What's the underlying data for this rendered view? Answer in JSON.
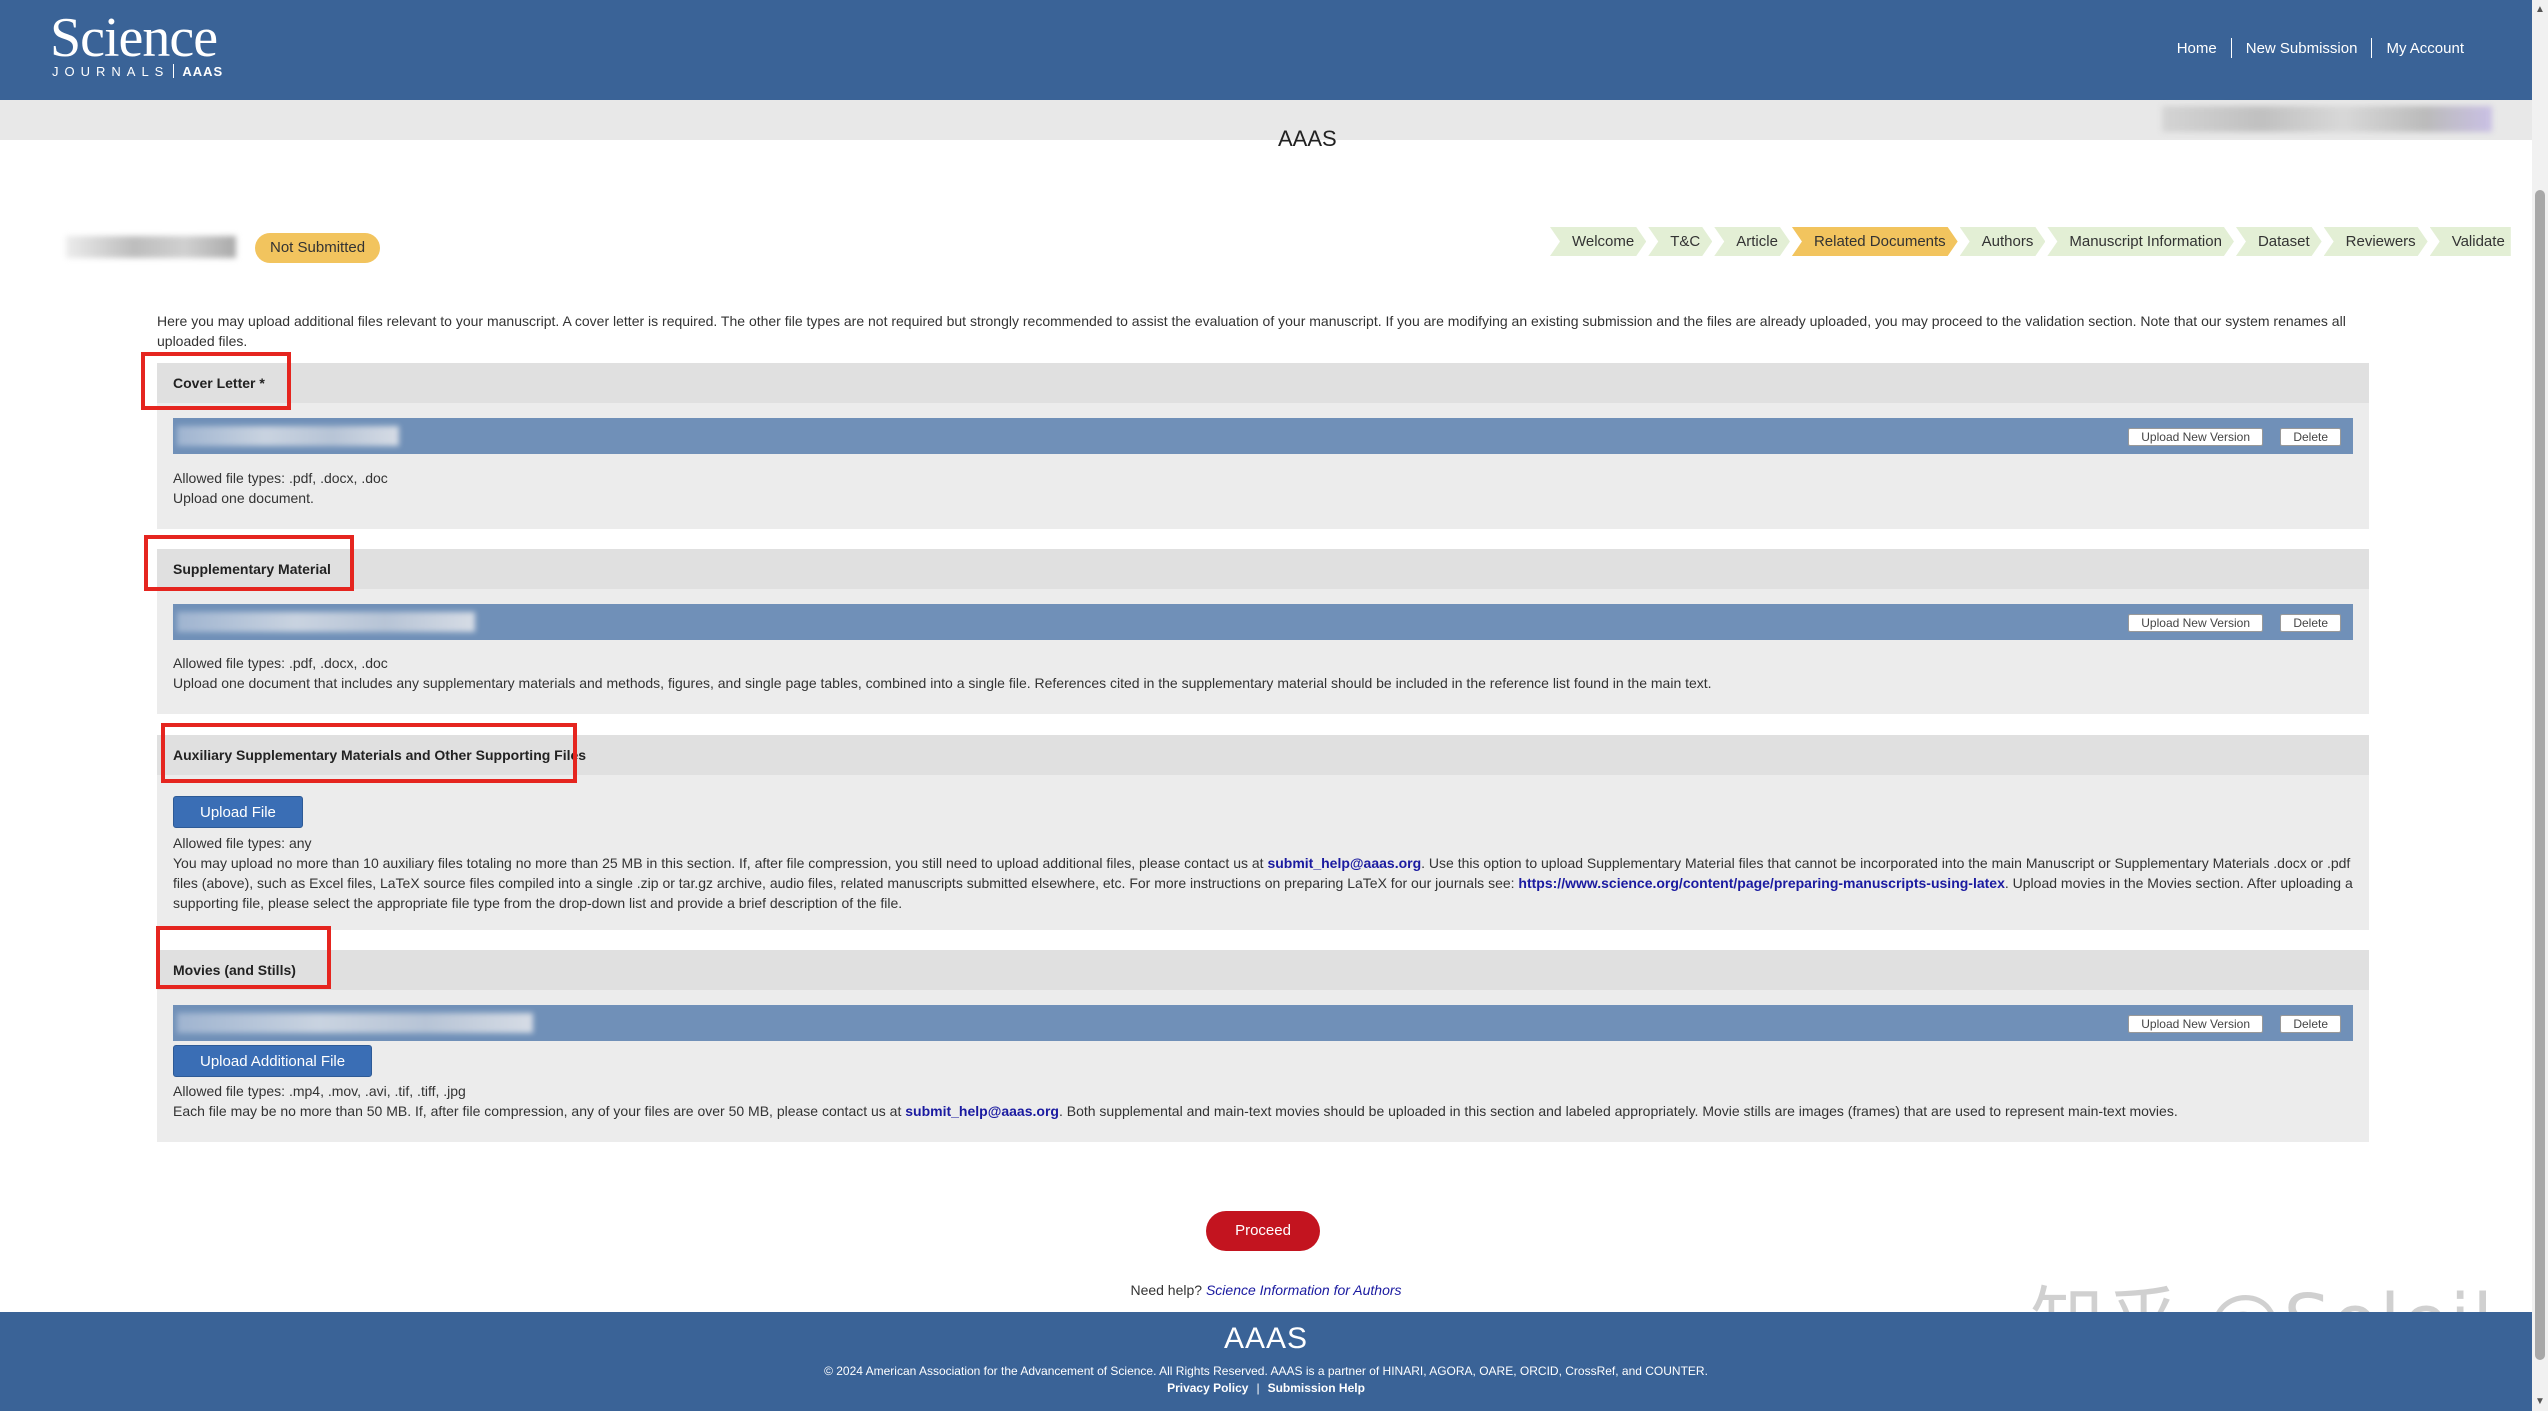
{
  "header": {
    "logo_main": "Science",
    "logo_sub": "JOURNALS",
    "logo_aaas": "AAAS",
    "nav": [
      "Home",
      "New Submission",
      "My Account"
    ]
  },
  "status": {
    "badge": "Not Submitted"
  },
  "steps": [
    {
      "label": "Welcome",
      "active": false
    },
    {
      "label": "T&C",
      "active": false
    },
    {
      "label": "Article",
      "active": false
    },
    {
      "label": "Related Documents",
      "active": true
    },
    {
      "label": "Authors",
      "active": false
    },
    {
      "label": "Manuscript Information",
      "active": false
    },
    {
      "label": "Dataset",
      "active": false
    },
    {
      "label": "Reviewers",
      "active": false
    },
    {
      "label": "Validate",
      "active": false
    }
  ],
  "intro": "Here you may upload additional files relevant to your manuscript. A cover letter is required. The other file types are not required but strongly recommended to assist the evaluation of your manuscript. If you are modifying an existing submission and the files are already uploaded, you may proceed to the validation section. Note that our system renames all uploaded files.",
  "buttons": {
    "upload_new_version": "Upload New Version",
    "delete": "Delete",
    "upload_file": "Upload File",
    "upload_additional_file": "Upload Additional File",
    "proceed": "Proceed"
  },
  "cover_letter": {
    "title": "Cover Letter *",
    "types": "Allowed file types: .pdf, .docx, .doc",
    "note": "Upload one document."
  },
  "supplementary": {
    "title": "Supplementary Material",
    "types": "Allowed file types: .pdf, .docx, .doc",
    "note": "Upload one document that includes any supplementary materials and methods, figures, and single page tables, combined into a single file. References cited in the supplementary material should be included in the reference list found in the main text."
  },
  "auxiliary": {
    "title": "Auxiliary Supplementary Materials and Other Supporting Files",
    "types": "Allowed file types: any",
    "note_1": "You may upload no more than 10 auxiliary files totaling no more than 25 MB in this section. If, after file compression, you still need to upload additional files, please contact us at ",
    "email": "submit_help@aaas.org",
    "note_2": ". Use this option to upload Supplementary Material files that cannot be incorporated into the main Manuscript or Supplementary Materials .docx or .pdf files (above), such as Excel files, LaTeX source files compiled into a single .zip or tar.gz archive, audio files, related manuscripts submitted elsewhere, etc. For more instructions on preparing LaTeX for our journals see: ",
    "latex_link": "https://www.science.org/content/page/preparing-manuscripts-using-latex",
    "note_3": ". Upload movies in the Movies section. After uploading a supporting file, please select the appropriate file type from the drop-down list and provide a brief description of the file."
  },
  "movies": {
    "title": "Movies (and Stills)",
    "types": "Allowed file types: .mp4, .mov, .avi, .tif, .tiff, .jpg",
    "note_1": "Each file may be no more than 50 MB. If, after file compression, any of your files are over 50 MB, please contact us at ",
    "email": "submit_help@aaas.org",
    "note_2": ". Both supplemental and main-text movies should be uploaded in this section and labeled appropriately. Movie stills are images (frames) that are used to represent main-text movies."
  },
  "help": {
    "prefix": "Need help? ",
    "link": "Science Information for Authors"
  },
  "watermark": "知乎 @Soleil",
  "footer": {
    "logo": "AAAS",
    "copyright": "© 2024 American Association for the Advancement of Science. All Rights Reserved. AAAS is a partner of HINARI, AGORA, OARE, ORCID, CrossRef, and COUNTER.",
    "links": [
      "Privacy Policy",
      "Submission Help"
    ]
  },
  "colors": {
    "header_bg": "#3a6397",
    "badge": "#f2c45e",
    "step": "#e3efd5",
    "proceed": "#c3141f",
    "highlight": "#e5251f"
  }
}
